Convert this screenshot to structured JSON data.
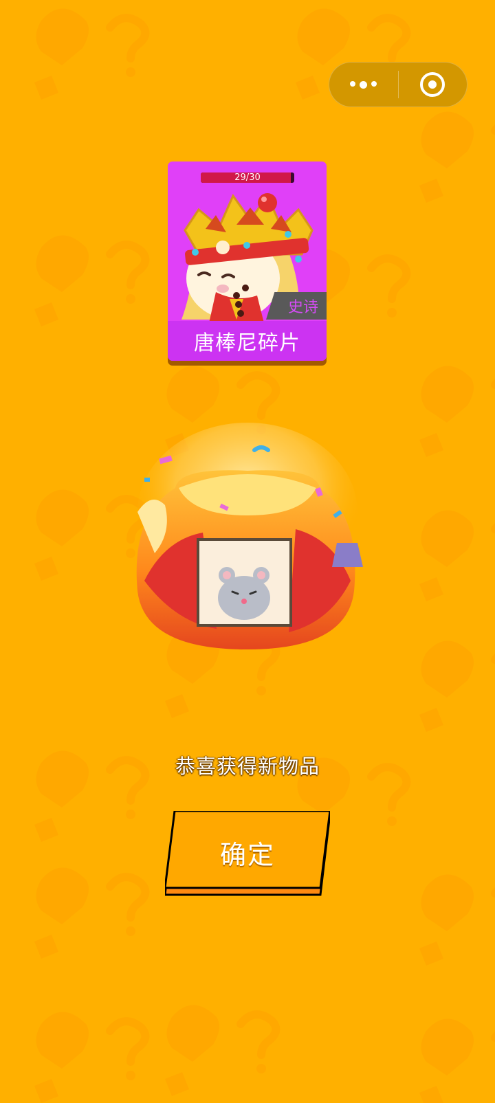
{
  "capsule": {
    "more_icon": "more-dots-icon",
    "close_icon": "target-close-icon"
  },
  "reward_card": {
    "progress_text": "29/30",
    "progress_value": 29,
    "progress_max": 30,
    "rarity": "史诗",
    "name": "唐棒尼碎片",
    "background_color": "#E040F8"
  },
  "message": "恭喜获得新物品",
  "confirm_button": {
    "label": "确定"
  },
  "colors": {
    "background": "#FFB000",
    "button": "#FFA800",
    "accent": "#CC33F2"
  }
}
